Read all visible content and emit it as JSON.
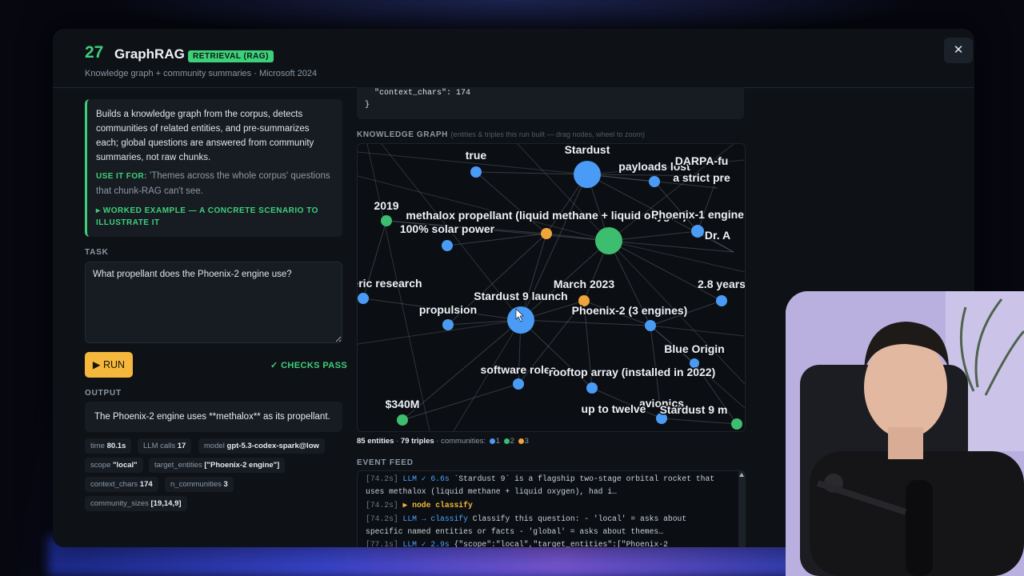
{
  "header": {
    "number": "27",
    "title": "GraphRAG",
    "badge": "RETRIEVAL (RAG)",
    "subtitle": "Knowledge graph + community summaries · Microsoft 2024",
    "close_label": "✕"
  },
  "description": {
    "text": "Builds a knowledge graph from the corpus, detects communities of related entities, and pre-summarizes each; global questions are answered from community summaries, not raw chunks.",
    "use_it_label": "USE IT FOR:",
    "use_it_text": "'Themes across the whole corpus' questions that chunk-RAG can't see.",
    "worked_example": "▸ WORKED EXAMPLE — A CONCRETE SCENARIO TO ILLUSTRATE IT"
  },
  "task": {
    "label": "TASK",
    "value": "What propellant does the Phoenix-2 engine use?"
  },
  "run_button": "▶ RUN",
  "checks": "✓ CHECKS PASS",
  "output": {
    "label": "OUTPUT",
    "text": "The Phoenix-2 engine uses **methalox** as its propellant.",
    "chips": [
      {
        "key": "time",
        "value": "80.1s"
      },
      {
        "key": "LLM calls",
        "value": "17"
      },
      {
        "key": "model",
        "value": "gpt-5.3-codex-spark@low"
      },
      {
        "key": "scope",
        "value": "\"local\""
      },
      {
        "key": "target_entities",
        "value": "[\"Phoenix-2 engine\"]"
      },
      {
        "key": "context_chars",
        "value": "174"
      },
      {
        "key": "n_communities",
        "value": "3"
      },
      {
        "key": "community_sizes",
        "value": "[19,14,9]"
      }
    ]
  },
  "context_json": {
    "line1": "\"context_chars\": 174",
    "line2": "}"
  },
  "graph": {
    "label": "KNOWLEDGE GRAPH",
    "hint": "(entities & triples this run built — drag nodes, wheel to zoom)",
    "colors": {
      "c1": "#4a9bf5",
      "c2": "#3dbd6e",
      "c3": "#f0a53b"
    },
    "nodes": [
      {
        "label": "true",
        "community": 1
      },
      {
        "label": "Stardust",
        "community": 1
      },
      {
        "label": "payloads lost",
        "community": 1
      },
      {
        "label": "DARPA-fu",
        "community": 1
      },
      {
        "label": "a strict pre",
        "community": 1
      },
      {
        "label": "2019",
        "community": 2
      },
      {
        "label": "methalox propellant (liquid methane + liquid oxygen)",
        "community": 3
      },
      {
        "label": "100% solar power",
        "community": 1
      },
      {
        "label": "Phoenix-1 engine",
        "community": 1
      },
      {
        "label": "Dr. A",
        "community": 1
      },
      {
        "label": "",
        "community": 2
      },
      {
        "label": "eric research",
        "community": 1
      },
      {
        "label": "Stardust 9 launch",
        "community": 1
      },
      {
        "label": "March 2023",
        "community": 3
      },
      {
        "label": "2.8 years",
        "community": 1
      },
      {
        "label": "propulsion",
        "community": 1
      },
      {
        "label": "Phoenix-2 (3 engines)",
        "community": 1
      },
      {
        "label": "Blue Origin",
        "community": 1
      },
      {
        "label": "software roles",
        "community": 1
      },
      {
        "label": "rooftop array (installed in 2022)",
        "community": 1
      },
      {
        "label": "$340M",
        "community": 2
      },
      {
        "label": "avionics",
        "community": 1
      },
      {
        "label": "up to twelve",
        "community": 1
      },
      {
        "label": "Stardust 9 m",
        "community": 1
      },
      {
        "label": "",
        "community": 2
      }
    ]
  },
  "graph_stats": {
    "entities": "85 entities",
    "triples": "79 triples",
    "communities_label": "· communities:",
    "community_ids": [
      "1",
      "2",
      "3"
    ]
  },
  "event_feed": {
    "label": "EVENT FEED",
    "lines": [
      {
        "time": "[74.2s]",
        "tag": "LLM ✓ 6.6s",
        "text": "`Stardust 9` is a flagship two-stage orbital rocket that"
      },
      {
        "time": "",
        "tag": "",
        "text": "uses methalox (liquid methane + liquid oxygen), had i…"
      },
      {
        "time": "[74.2s]",
        "tag": "▶ node classify",
        "text": ""
      },
      {
        "time": "[74.2s]",
        "tag": "LLM → classify",
        "text": "Classify this question: - 'local' = asks about"
      },
      {
        "time": "",
        "tag": "",
        "text": "specific named entities or facts - 'global' = asks about themes…"
      },
      {
        "time": "[77.1s]",
        "tag": "LLM ✓ 2.9s",
        "text": "{\"scope\":\"local\",\"target_entities\":[\"Phoenix-2"
      }
    ]
  }
}
